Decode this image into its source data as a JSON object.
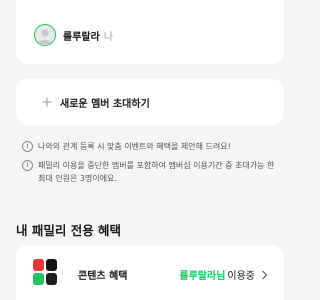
{
  "member": {
    "name": "룰루랄라",
    "self_tag": "나"
  },
  "invite": {
    "label": "새로운 멤버 초대하기"
  },
  "notes": [
    "나와의 관계 등록 시 맞춤 이벤트와 혜택을 제안해 드려요!",
    "패밀리 이용을 중단한 멤버를 포함하여 멤버십 이용기간 중 초대가능 한 최대 인원은 3명이에요."
  ],
  "benefits_section": {
    "title": "내 패밀리 전용 혜택"
  },
  "benefit": {
    "label": "콘텐츠 혜택",
    "brand": "룰루랄라님",
    "status": "이용중"
  },
  "colors": {
    "accent_green": "#22c55e",
    "background": "#f5f5f7",
    "card": "#ffffff"
  },
  "icons": {
    "avatar": "default-profile-avatar",
    "invite": "plus-icon",
    "note": "info-circle-icon",
    "benefit": "content-apps-icon",
    "status_arrow": "chevron-right-icon"
  }
}
